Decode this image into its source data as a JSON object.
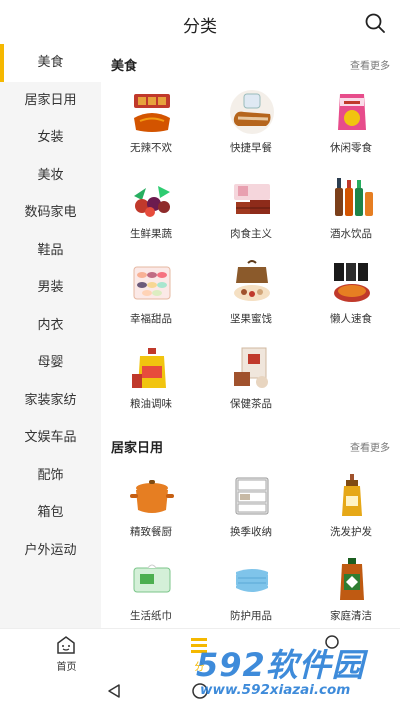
{
  "header": {
    "title": "分类"
  },
  "sidebar": {
    "items": [
      {
        "label": "美食"
      },
      {
        "label": "居家日用"
      },
      {
        "label": "女装"
      },
      {
        "label": "美妆"
      },
      {
        "label": "数码家电"
      },
      {
        "label": "鞋品"
      },
      {
        "label": "男装"
      },
      {
        "label": "内衣"
      },
      {
        "label": "母婴"
      },
      {
        "label": "家装家纺"
      },
      {
        "label": "文娱车品"
      },
      {
        "label": "配饰"
      },
      {
        "label": "箱包"
      },
      {
        "label": "户外运动"
      }
    ]
  },
  "sections": [
    {
      "title": "美食",
      "more": "查看更多",
      "items": [
        {
          "label": "无辣不欢",
          "icon": "meat-snack-icon"
        },
        {
          "label": "快捷早餐",
          "icon": "bread-icon"
        },
        {
          "label": "休闲零食",
          "icon": "chips-bag-icon"
        },
        {
          "label": "生鲜果蔬",
          "icon": "fruit-icon"
        },
        {
          "label": "肉食主义",
          "icon": "meat-box-icon"
        },
        {
          "label": "酒水饮品",
          "icon": "bottles-icon"
        },
        {
          "label": "幸福甜品",
          "icon": "macaron-icon"
        },
        {
          "label": "坚果蜜饯",
          "icon": "nuts-gift-icon"
        },
        {
          "label": "懒人速食",
          "icon": "instant-noodle-icon"
        },
        {
          "label": "粮油调味",
          "icon": "cooking-oil-icon"
        },
        {
          "label": "保健茶品",
          "icon": "tea-box-icon"
        }
      ]
    },
    {
      "title": "居家日用",
      "more": "查看更多",
      "items": [
        {
          "label": "精致餐厨",
          "icon": "cooking-pot-icon"
        },
        {
          "label": "换季收纳",
          "icon": "storage-drawer-icon"
        },
        {
          "label": "洗发护发",
          "icon": "shampoo-bottle-icon"
        },
        {
          "label": "生活纸巾",
          "icon": "tissue-pack-icon"
        },
        {
          "label": "防护用品",
          "icon": "face-mask-icon"
        },
        {
          "label": "家庭清洁",
          "icon": "disinfectant-bottle-icon"
        }
      ]
    }
  ],
  "bottom_nav": [
    {
      "label": "首页",
      "icon": "home-face-icon"
    },
    {
      "label": "分",
      "icon": "category-icon"
    },
    {
      "label": "",
      "icon": "profile-icon"
    }
  ],
  "watermark": {
    "brand": "592软件园",
    "url": "www.592xiazai.com"
  },
  "colors": {
    "accent": "#f5b800",
    "sidebar_bg": "#f5f5f5",
    "watermark": "#2a7fd6"
  }
}
